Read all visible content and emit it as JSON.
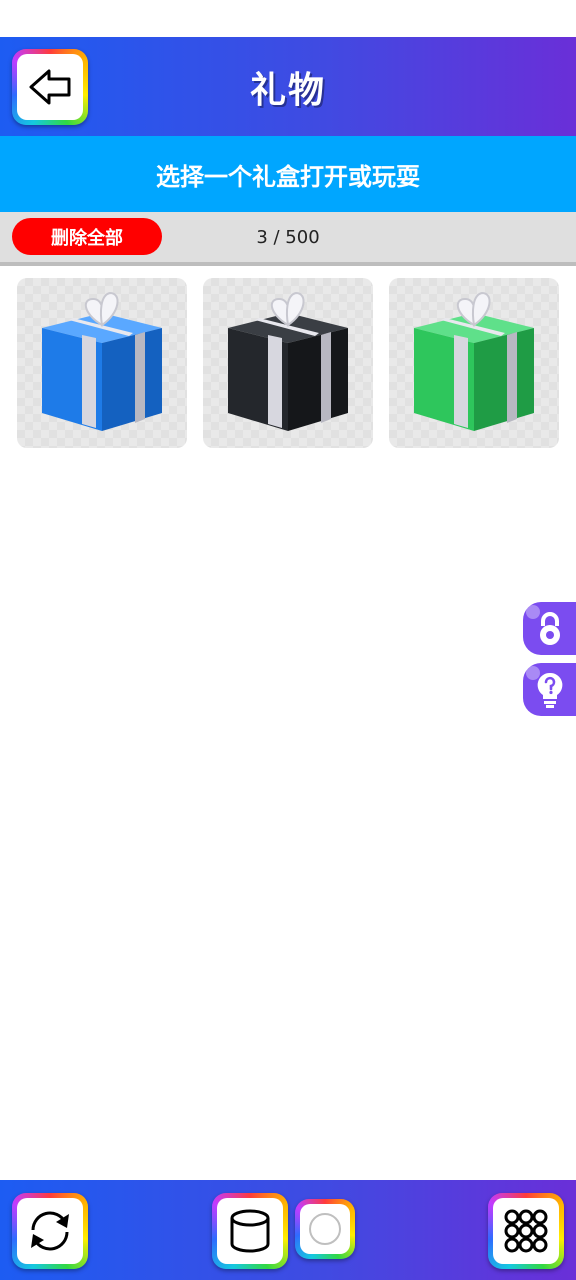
{
  "header": {
    "title": "礼物"
  },
  "banner": {
    "text": "选择一个礼盒打开或玩耍"
  },
  "toolbar": {
    "delete_all_label": "删除全部",
    "counter": "3 / 500"
  },
  "gifts": [
    {
      "color_name": "blue",
      "color": "#1e7be8"
    },
    {
      "color_name": "black",
      "color": "#1f2226"
    },
    {
      "color_name": "green",
      "color": "#2ec65c"
    }
  ],
  "side_buttons": [
    {
      "icon": "lock-icon"
    },
    {
      "icon": "lightbulb-question-icon"
    }
  ],
  "bottom_bar": {
    "buttons": [
      {
        "icon": "refresh-icon"
      },
      {
        "icon": "cylinder-icon"
      },
      {
        "icon": "circle-icon"
      },
      {
        "icon": "grid-menu-icon"
      }
    ]
  },
  "colors": {
    "header_gradient_start": "#1d5cf2",
    "header_gradient_end": "#6a2fd8",
    "banner": "#00a6ff",
    "delete_button": "#ff0000",
    "side_buttons": "#7b4cf0"
  }
}
